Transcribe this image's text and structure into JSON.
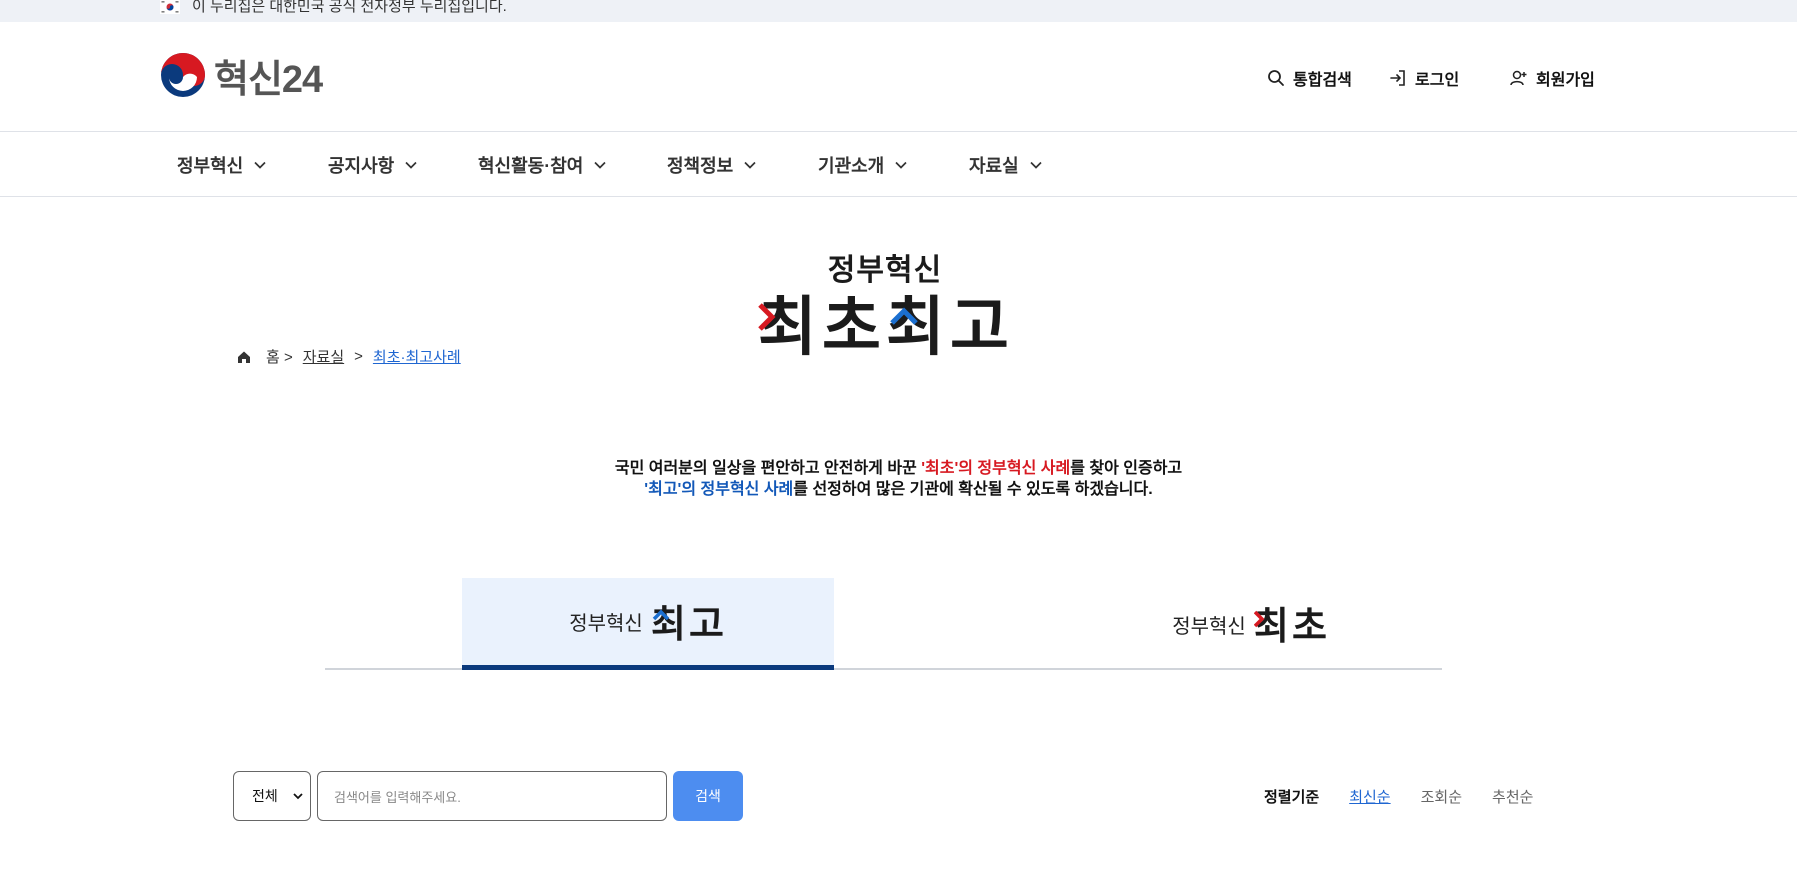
{
  "gov_banner": {
    "text": "이 누리집은 대한민국 공식 전자정부 누리집입니다."
  },
  "header": {
    "logo_text": "혁신24",
    "utility": {
      "search": "통합검색",
      "login": "로그인",
      "join": "회원가입"
    }
  },
  "nav": [
    "정부혁신",
    "공지사항",
    "혁신활동·참여",
    "정책정보",
    "기관소개",
    "자료실"
  ],
  "hero": {
    "small": "정부혁신",
    "big": [
      "최",
      "초",
      "최",
      "고"
    ]
  },
  "breadcrumb": {
    "home": "홈 >",
    "level1": "자료실",
    "sep": ">",
    "current": "최초·최고사례"
  },
  "intro": {
    "line1_a": "국민 여러분의 일상을 편안하고 안전하게 바꾼 ",
    "line1_red": "'최초'의 정부혁신 사례",
    "line1_b": "를 찾아 인증하고",
    "line2_blue": "'최고'의 정부혁신 사례",
    "line2_b": "를 선정하여 많은 기관에 확산될 수 있도록 하겠습니다."
  },
  "tabs": {
    "best": {
      "small": "정부혁신",
      "big": [
        "최",
        "고"
      ]
    },
    "first": {
      "small": "정부혁신",
      "big": [
        "최",
        "초"
      ]
    }
  },
  "search": {
    "select_value": "전체",
    "placeholder": "검색어를 입력해주세요.",
    "button": "검색"
  },
  "sort": {
    "label": "정렬기준",
    "options": [
      "최신순",
      "조회순",
      "추천순"
    ]
  },
  "colors": {
    "accent_blue": "#1f66d1",
    "red": "#d71921",
    "navy": "#0b3a7d",
    "button_blue": "#4d8df0"
  }
}
